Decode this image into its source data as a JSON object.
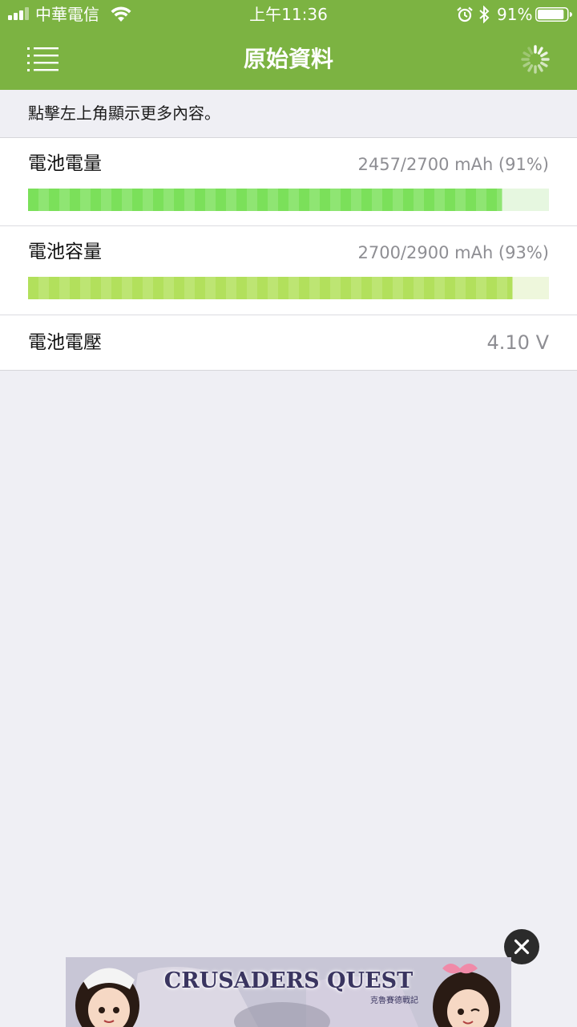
{
  "status_bar": {
    "carrier": "中華電信",
    "time": "上午11:36",
    "battery_percent": "91%",
    "battery_level": 0.91,
    "icons": [
      "signal-icon",
      "wifi-icon",
      "alarm-icon",
      "bluetooth-icon",
      "battery-icon"
    ]
  },
  "nav": {
    "title": "原始資料",
    "left_icon": "menu-list-icon",
    "right_icon": "loading-spinner-icon"
  },
  "hint": "點擊左上角顯示更多內容。",
  "battery_info": {
    "charge": {
      "label": "電池電量",
      "value": "2457/2700 mAh (91%)",
      "fraction": 0.91,
      "bar_color": "#7be05a",
      "track_color": "#e6f7e0"
    },
    "capacity": {
      "label": "電池容量",
      "value": "2700/2900 mAh (93%)",
      "fraction": 0.93,
      "bar_color": "#b2e05c",
      "track_color": "#eef7dc"
    },
    "voltage": {
      "label": "電池電壓",
      "value": "4.10 V"
    }
  },
  "ad": {
    "title": "CRUSADERS QUEST",
    "subtitle": "克魯賽德戰記",
    "close_icon": "close-icon"
  },
  "colors": {
    "header_green": "#7cb342",
    "page_background": "#efeff4",
    "value_gray": "#8e8e93"
  }
}
